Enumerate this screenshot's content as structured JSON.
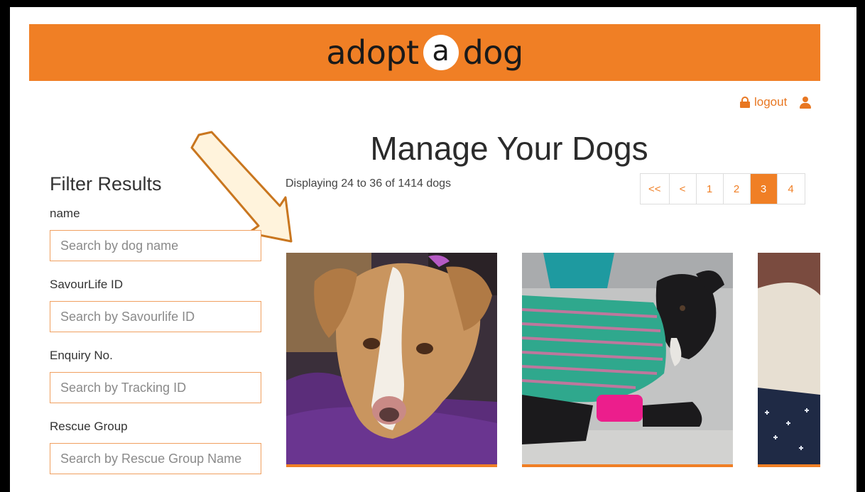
{
  "header": {
    "logo_left": "adopt",
    "logo_middle": "a",
    "logo_right": "dog"
  },
  "account": {
    "logout_label": "logout",
    "lock_icon": "lock-icon",
    "user_icon": "user-icon"
  },
  "page": {
    "title": "Manage Your Dogs",
    "displaying": "Displaying 24 to 36 of 1414 dogs"
  },
  "filters": {
    "title": "Filter Results",
    "fields": [
      {
        "label": "name",
        "placeholder": "Search by dog name"
      },
      {
        "label": "SavourLife ID",
        "placeholder": "Search by Savourlife ID"
      },
      {
        "label": "Enquiry No.",
        "placeholder": "Search by Tracking ID"
      },
      {
        "label": "Rescue Group",
        "placeholder": "Search by Rescue Group Name"
      }
    ]
  },
  "pagination": {
    "first": "<<",
    "prev": "<",
    "pages": [
      "1",
      "2",
      "3",
      "4"
    ],
    "current": "3"
  },
  "dogs": [
    {
      "photo": "tan-and-white-dog-on-purple-blanket"
    },
    {
      "photo": "black-dog-in-green-striped-jumper"
    },
    {
      "photo": "cream-dog-on-navy-bed"
    }
  ],
  "colors": {
    "brand_orange": "#f07f25",
    "input_border": "#f0a060"
  }
}
